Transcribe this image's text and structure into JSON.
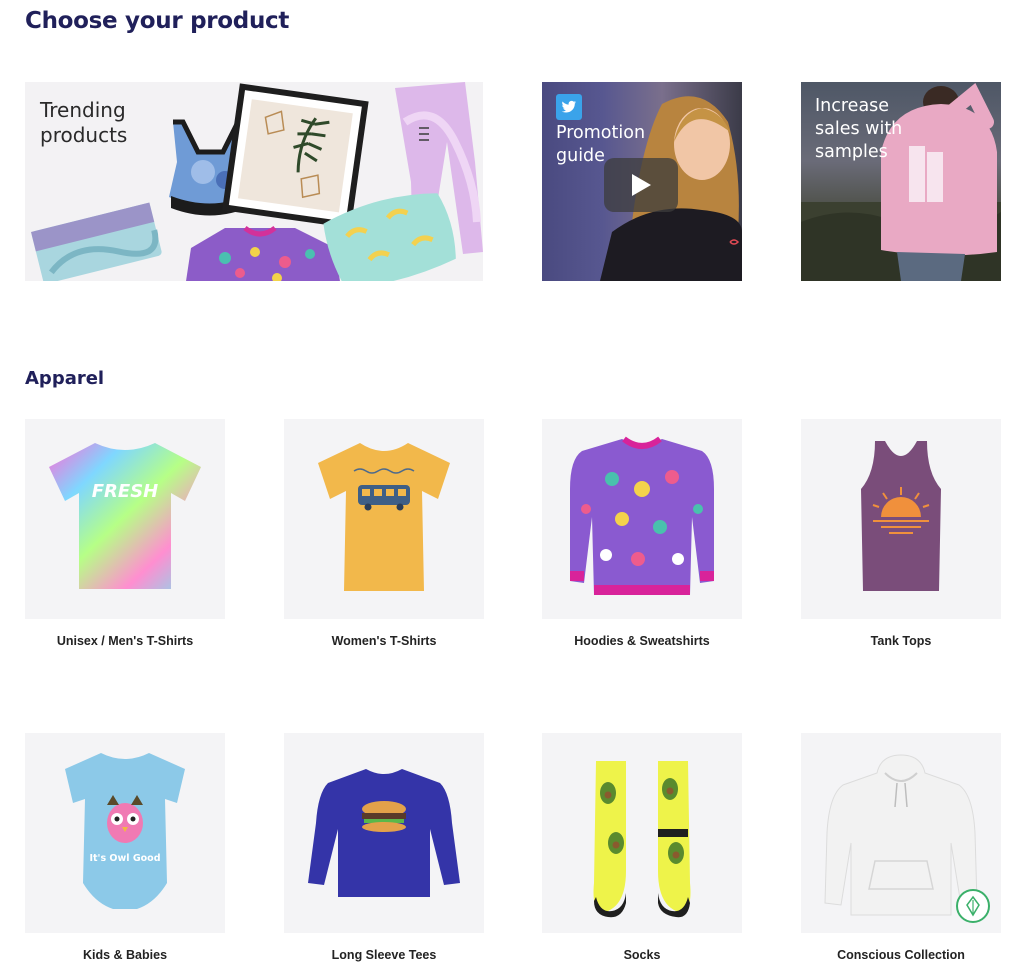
{
  "page": {
    "title": "Choose your product",
    "section_title": "Apparel"
  },
  "banners": [
    {
      "text": "Trending products"
    },
    {
      "text": "Promotion guide"
    },
    {
      "text": "Increase sales with samples"
    }
  ],
  "products": [
    {
      "label": "Unisex / Men's T-Shirts",
      "print_text": "FRESH"
    },
    {
      "label": "Women's T-Shirts"
    },
    {
      "label": "Hoodies & Sweatshirts"
    },
    {
      "label": "Tank Tops"
    },
    {
      "label": "Kids & Babies",
      "print_text": "It's Owl Good"
    },
    {
      "label": "Long Sleeve Tees"
    },
    {
      "label": "Socks"
    },
    {
      "label": "Conscious Collection"
    }
  ],
  "colors": {
    "heading": "#20205a",
    "tile_bg": "#f4f4f6",
    "tshirt_womens": "#f2b84b",
    "tank": "#7a4d7a",
    "kids": "#8cc9e8",
    "long_sleeve": "#3434a8",
    "hoodie_white": "#f2f2f2"
  }
}
